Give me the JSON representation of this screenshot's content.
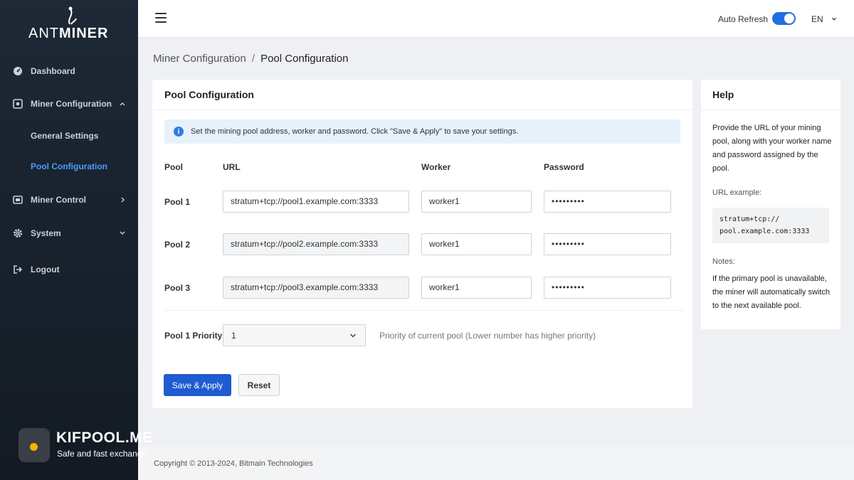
{
  "brand": {
    "logo_regular": "ANT",
    "logo_bold": "MINER"
  },
  "sidebar": {
    "items": [
      {
        "label": "Dashboard",
        "icon": "dashboard-icon"
      },
      {
        "label": "Miner Configuration",
        "icon": "config-icon",
        "expanded": true
      },
      {
        "label": "General Settings"
      },
      {
        "label": "Pool Configuration",
        "active": true
      },
      {
        "label": "Miner Control",
        "icon": "control-icon"
      },
      {
        "label": "System",
        "icon": "gear-icon"
      },
      {
        "label": "Logout",
        "icon": "logout-icon"
      }
    ]
  },
  "topbar": {
    "auto_refresh_label": "Auto Refresh",
    "auto_refresh_on": true,
    "language": "EN"
  },
  "breadcrumb": {
    "parent": "Miner Configuration",
    "separator": "/",
    "current": "Pool Configuration"
  },
  "pool_card": {
    "title": "Pool Configuration",
    "info": "Set the mining pool address, worker and password. Click \"Save & Apply\" to save your settings.",
    "headers": {
      "pool": "Pool",
      "url": "URL",
      "worker": "Worker",
      "password": "Password"
    },
    "pools": [
      {
        "label": "Pool 1",
        "url": "stratum+tcp://pool1.example.com:3333",
        "worker": "worker1",
        "password": "•••••••••"
      },
      {
        "label": "Pool 2",
        "url": "stratum+tcp://pool2.example.com:3333",
        "worker": "worker1",
        "password": "•••••••••"
      },
      {
        "label": "Pool 3",
        "url": "stratum+tcp://pool3.example.com:3333",
        "worker": "worker1",
        "password": "•••••••••"
      }
    ],
    "priority_label": "Pool 1 Priority",
    "priority_value": "1",
    "priority_hint": "Priority of current pool (Lower number has higher priority)",
    "save_label": "Save & Apply",
    "reset_label": "Reset"
  },
  "help": {
    "title": "Help",
    "intro": "Provide the URL of your mining pool, along with your worker name and password assigned by the pool.",
    "url_example_label": "URL example:",
    "url_example_line1": "stratum+tcp://",
    "url_example_line2": "pool.example.com:3333",
    "notes_label": "Notes:",
    "notes": "If the primary pool is unavailable, the miner will automatically switch to the next available pool."
  },
  "footer": {
    "copyright": "Copyright © 2013-2024, Bitmain Technologies"
  },
  "watermark": {
    "title": "KIFPOOL.ME",
    "subtitle": "Safe and fast exchange"
  },
  "colors": {
    "accent": "#1f5bd1",
    "sidebar_bg": "#1e2936",
    "active_link": "#4a9dff"
  }
}
